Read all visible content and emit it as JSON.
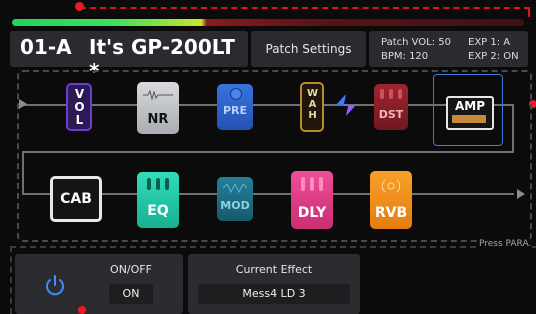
{
  "header": {
    "patch_number": "01-A",
    "patch_name": "It's GP-200LT *",
    "settings_label": "Patch Settings",
    "patch_vol": "Patch VOL: 50",
    "bpm": "BPM: 120",
    "exp1": "EXP 1:  A",
    "exp2": "EXP 2: ON"
  },
  "chain": {
    "row1": [
      {
        "label": "VOL",
        "color": "#6a3fd0"
      },
      {
        "label": "NR",
        "color": "#c9cbcf"
      },
      {
        "label": "PRE",
        "color": "#2f5fc6"
      },
      {
        "label": "WAH",
        "color": "#b88a2b"
      },
      {
        "label": "DST",
        "color": "#8b1e28"
      },
      {
        "label": "AMP",
        "color": "#1a1a1a"
      }
    ],
    "row2": [
      {
        "label": "CAB",
        "color": "#141414"
      },
      {
        "label": "EQ",
        "color": "#1fc9a8"
      },
      {
        "label": "MOD",
        "color": "#1f6f86"
      },
      {
        "label": "DLY",
        "color": "#e2418a"
      },
      {
        "label": "RVB",
        "color": "#f2901d"
      }
    ],
    "hint": "Press PARA."
  },
  "power": {
    "caption": "ON/OFF",
    "value": "ON"
  },
  "effect": {
    "caption": "Current Effect",
    "value": "Mess4 LD  3"
  },
  "meter_level": 0.37
}
